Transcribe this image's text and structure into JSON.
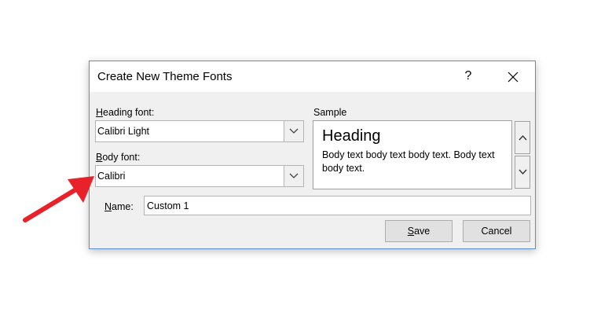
{
  "dialog": {
    "title": "Create New Theme Fonts",
    "help_label": "?",
    "close_icon": "close-icon"
  },
  "heading_font": {
    "label_accel": "H",
    "label_rest": "eading font:",
    "value": "Calibri Light"
  },
  "body_font": {
    "label_accel": "B",
    "label_rest": "ody font:",
    "value": "Calibri"
  },
  "sample": {
    "label": "Sample",
    "heading": "Heading",
    "body": "Body text body text body text. Body text body text."
  },
  "name": {
    "label_accel": "N",
    "label_rest": "ame:",
    "value": "Custom 1"
  },
  "buttons": {
    "save_accel": "S",
    "save_rest": "ave",
    "cancel": "Cancel"
  },
  "colors": {
    "annotation_arrow": "#e8222a",
    "dialog_border": "#5a8fd0"
  }
}
